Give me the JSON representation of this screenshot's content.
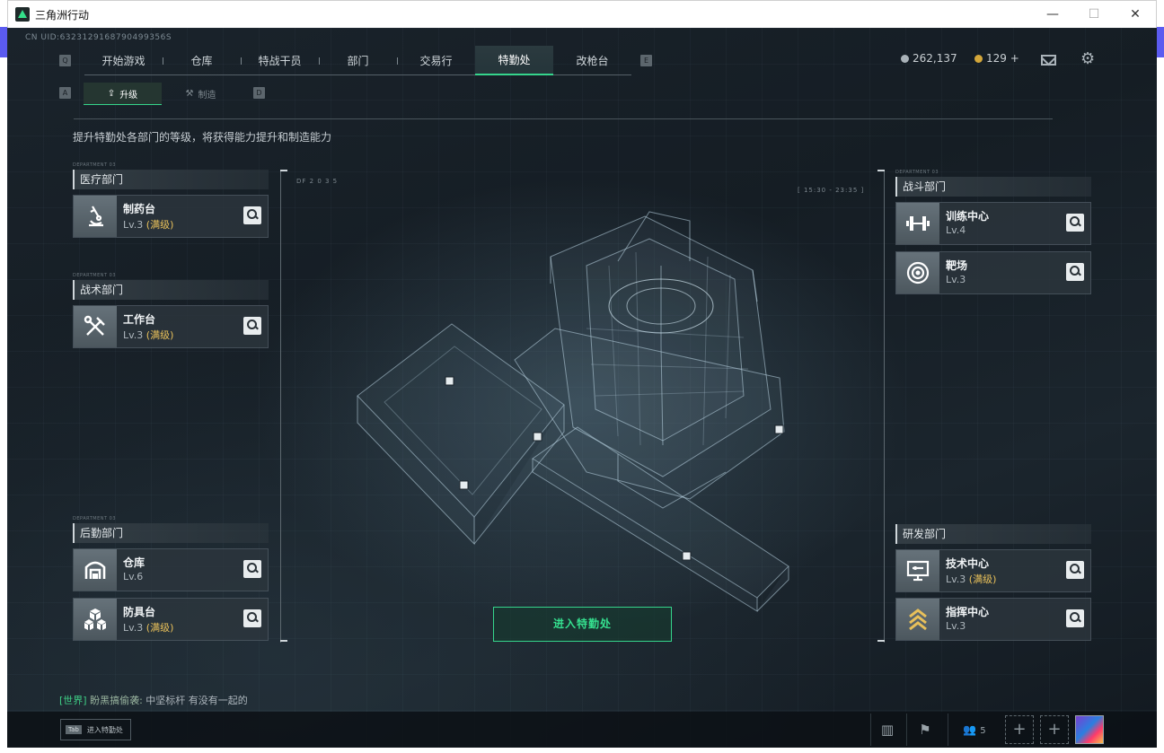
{
  "window": {
    "title": "三角洲行动"
  },
  "uid": "CN UID:6323129168790499356S",
  "nav": {
    "left_key": "Q",
    "right_key": "E",
    "items": [
      "开始游戏",
      "仓库",
      "特战干员",
      "部门",
      "交易行",
      "特勤处",
      "改枪台"
    ],
    "active_index": 5
  },
  "currency": {
    "silver": "262,137",
    "gold": "129 +"
  },
  "subtabs": {
    "left_key": "A",
    "right_key": "D",
    "items": [
      "升级",
      "制造"
    ],
    "active_index": 0
  },
  "description": "提升特勤处各部门的等级，将获得能力提升和制造能力",
  "dept_tag": "DEPARTMENT 03",
  "departments": {
    "medical": {
      "name": "医疗部门",
      "facilities": [
        {
          "name": "制药台",
          "level": "Lv.3",
          "status": "(满级)",
          "icon": "microscope-icon"
        }
      ]
    },
    "tactical": {
      "name": "战术部门",
      "facilities": [
        {
          "name": "工作台",
          "level": "Lv.3",
          "status": "(满级)",
          "icon": "hammer-wrench-icon"
        }
      ]
    },
    "logistics": {
      "name": "后勤部门",
      "facilities": [
        {
          "name": "仓库",
          "level": "Lv.6",
          "status": "",
          "icon": "warehouse-icon"
        },
        {
          "name": "防具台",
          "level": "Lv.3",
          "status": "(满级)",
          "icon": "armor-boxes-icon"
        }
      ]
    },
    "combat": {
      "name": "战斗部门",
      "facilities": [
        {
          "name": "训练中心",
          "level": "Lv.4",
          "status": "",
          "icon": "dumbbell-icon"
        },
        {
          "name": "靶场",
          "level": "Lv.3",
          "status": "",
          "icon": "target-icon"
        }
      ]
    },
    "research": {
      "name": "研发部门",
      "facilities": [
        {
          "name": "技术中心",
          "level": "Lv.3",
          "status": "(满级)",
          "icon": "monitor-icon"
        },
        {
          "name": "指挥中心",
          "level": "Lv.3",
          "status": "",
          "icon": "chevron-rank-icon"
        }
      ]
    }
  },
  "hud": {
    "code": "DF 2 0 3 5",
    "time": "[ 15:30 - 23:35 ]"
  },
  "enter_button": "进入特勤处",
  "chat": {
    "channel": "[世界]",
    "user": "盼黑搞偷袭:",
    "message": " 中坚标杆 有没有一起的"
  },
  "bottom": {
    "tab_key": "Tab",
    "tab_label": "进入特勤处",
    "friends_count": "5"
  },
  "colors": {
    "accent": "#35d58c",
    "max_level": "#e8c05a",
    "panel": "#2c363d"
  }
}
